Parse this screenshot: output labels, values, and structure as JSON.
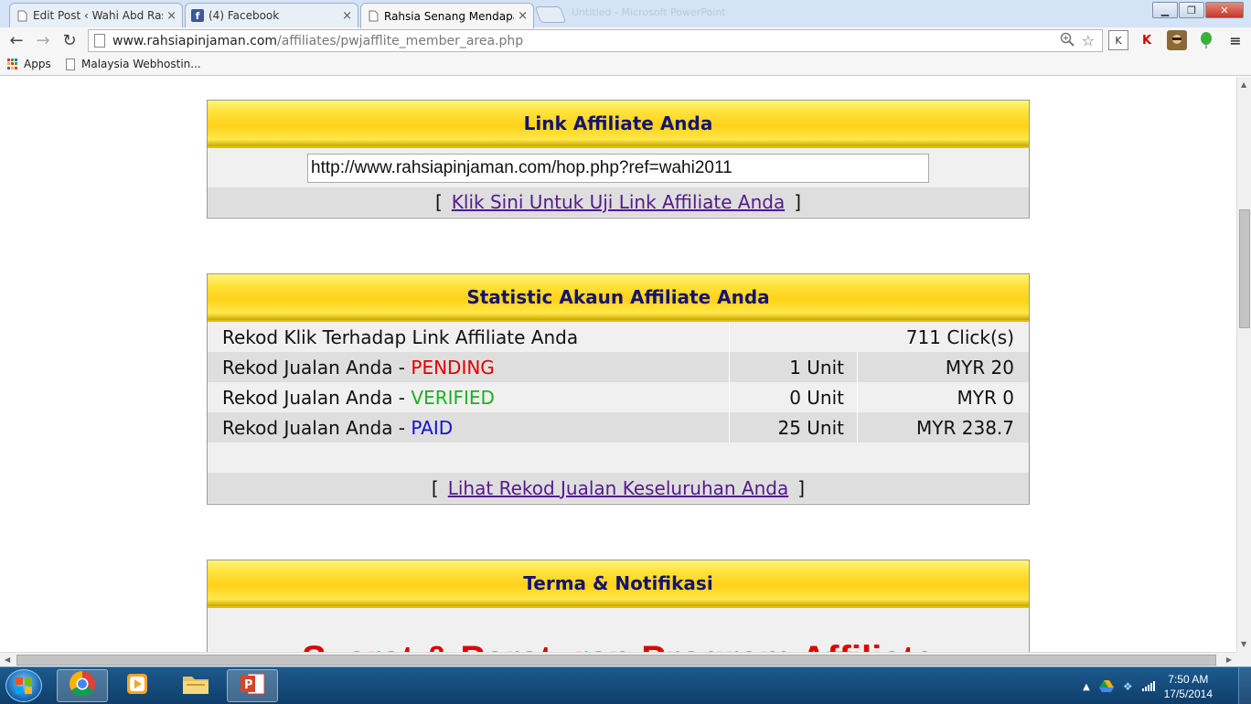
{
  "browser": {
    "tabs": [
      {
        "title": "Edit Post ‹ Wahi Abd Rash",
        "icon": "page-icon",
        "active": false
      },
      {
        "title": "(4) Facebook",
        "icon": "facebook-icon",
        "active": false
      },
      {
        "title": "Rahsia Senang Mendapat",
        "icon": "page-icon",
        "active": true
      }
    ],
    "ghost_title": "Untitled - Microsoft PowerPoint",
    "url_host": "www.rahsiapinjaman.com",
    "url_path": "/affiliates/pwjafflite_member_area.php",
    "bookmarks": [
      {
        "label": "Apps",
        "icon": "apps-grid-icon"
      },
      {
        "label": "Malaysia Webhostin...",
        "icon": "page-icon"
      }
    ]
  },
  "affiliate_link_panel": {
    "title": "Link Affiliate Anda",
    "link_value": "http://www.rahsiapinjaman.com/hop.php?ref=wahi2011",
    "bracket_open": "[",
    "test_link_label": "Klik Sini Untuk Uji Link Affiliate Anda",
    "bracket_close": "]"
  },
  "statistics_panel": {
    "title": "Statistic Akaun Affiliate Anda",
    "clicks_row": {
      "label": "Rekod Klik Terhadap Link Affiliate Anda",
      "value": "711 Click(s)"
    },
    "sales_rows": [
      {
        "prefix": "Rekod Jualan Anda - ",
        "status": "PENDING",
        "status_color": "#e00000",
        "units": "1 Unit",
        "amount": "MYR 20"
      },
      {
        "prefix": "Rekod Jualan Anda - ",
        "status": "VERIFIED",
        "status_color": "#1db01d",
        "units": "0 Unit",
        "amount": "MYR 0"
      },
      {
        "prefix": "Rekod Jualan Anda - ",
        "status": "PAID",
        "status_color": "#1414c8",
        "units": "25 Unit",
        "amount": "MYR 238.7"
      }
    ],
    "bracket_open": "[",
    "view_all_label": "Lihat Rekod Jualan Keseluruhan Anda",
    "bracket_close": "]"
  },
  "terms_panel": {
    "title": "Terma & Notifikasi",
    "heading_partial": "Syarat & Peraturan Program Affiliate"
  },
  "taskbar": {
    "apps": [
      "chrome-icon",
      "media-player-icon",
      "file-explorer-icon",
      "powerpoint-icon"
    ],
    "clock_time": "7:50 AM",
    "clock_date": "17/5/2014"
  },
  "colors": {
    "panel_title": "#14146e",
    "link": "#551a8b",
    "header_yellow": "#ffd21a"
  }
}
